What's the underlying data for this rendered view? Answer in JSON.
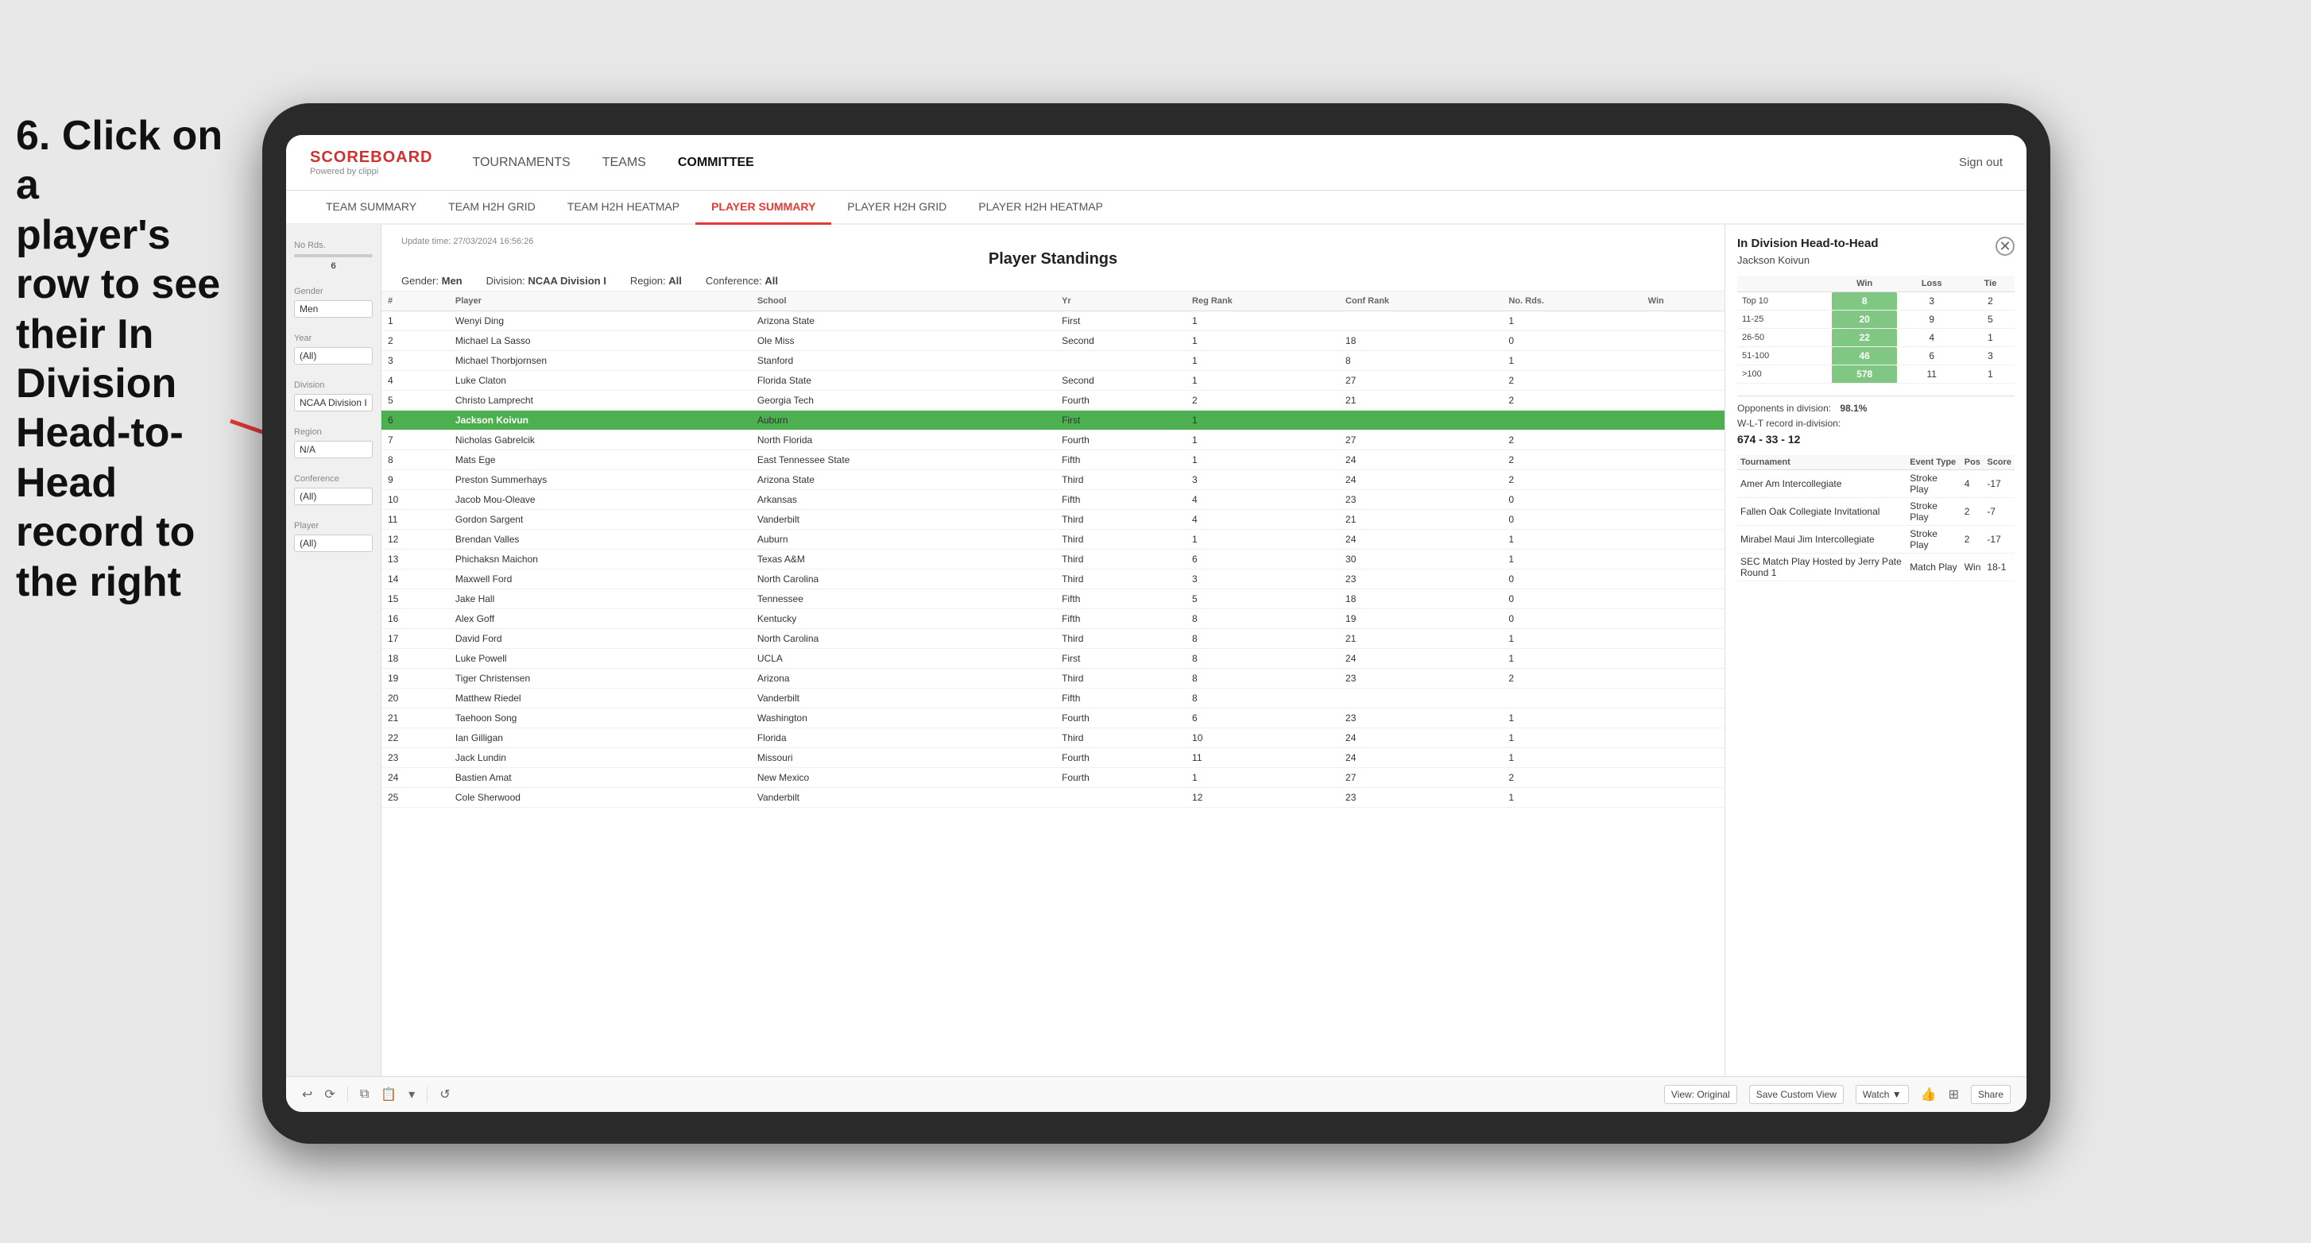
{
  "instruction": {
    "line1": "6. Click on a",
    "line2": "player's row to see",
    "line3": "their In Division",
    "line4": "Head-to-Head",
    "line5": "record to the right"
  },
  "brand": {
    "title": "SCOREBOARD",
    "sub": "Powered by clippi"
  },
  "nav": {
    "items": [
      "TOURNAMENTS",
      "TEAMS",
      "COMMITTEE"
    ],
    "sign_out": "Sign out"
  },
  "sub_nav": {
    "items": [
      "TEAM SUMMARY",
      "TEAM H2H GRID",
      "TEAM H2H HEATMAP",
      "PLAYER SUMMARY",
      "PLAYER H2H GRID",
      "PLAYER H2H HEATMAP"
    ],
    "active": "PLAYER SUMMARY"
  },
  "panel": {
    "title": "Player Standings",
    "update_time": "Update time: 27/03/2024 16:56:26",
    "filters": {
      "gender_label": "Gender:",
      "gender_value": "Men",
      "division_label": "Division:",
      "division_value": "NCAA Division I",
      "region_label": "Region:",
      "region_value": "All",
      "conference_label": "Conference:",
      "conference_value": "All"
    }
  },
  "table": {
    "headers": [
      "#",
      "Player",
      "School",
      "Yr",
      "Reg Rank",
      "Conf Rank",
      "No. Rds.",
      "Win"
    ],
    "rows": [
      {
        "num": 1,
        "player": "Wenyi Ding",
        "school": "Arizona State",
        "yr": "First",
        "reg": 1,
        "conf": "",
        "rds": 1,
        "win": ""
      },
      {
        "num": 2,
        "player": "Michael La Sasso",
        "school": "Ole Miss",
        "yr": "Second",
        "reg": 1,
        "conf": 18,
        "rds": 0,
        "win": ""
      },
      {
        "num": 3,
        "player": "Michael Thorbjornsen",
        "school": "Stanford",
        "yr": "",
        "reg": 1,
        "conf": 8,
        "rds": 1,
        "win": ""
      },
      {
        "num": 4,
        "player": "Luke Claton",
        "school": "Florida State",
        "yr": "Second",
        "reg": 1,
        "conf": 27,
        "rds": 2,
        "win": ""
      },
      {
        "num": 5,
        "player": "Christo Lamprecht",
        "school": "Georgia Tech",
        "yr": "Fourth",
        "reg": 2,
        "conf": 21,
        "rds": 2,
        "win": ""
      },
      {
        "num": 6,
        "player": "Jackson Koivun",
        "school": "Auburn",
        "yr": "First",
        "reg": 1,
        "conf": "",
        "rds": "",
        "win": ""
      },
      {
        "num": 7,
        "player": "Nicholas Gabrelcik",
        "school": "North Florida",
        "yr": "Fourth",
        "reg": 1,
        "conf": 27,
        "rds": 2,
        "win": ""
      },
      {
        "num": 8,
        "player": "Mats Ege",
        "school": "East Tennessee State",
        "yr": "Fifth",
        "reg": 1,
        "conf": 24,
        "rds": 2,
        "win": ""
      },
      {
        "num": 9,
        "player": "Preston Summerhays",
        "school": "Arizona State",
        "yr": "Third",
        "reg": 3,
        "conf": 24,
        "rds": 2,
        "win": ""
      },
      {
        "num": 10,
        "player": "Jacob Mou-Oleave",
        "school": "Arkansas",
        "yr": "Fifth",
        "reg": 4,
        "conf": 23,
        "rds": 0,
        "win": ""
      },
      {
        "num": 11,
        "player": "Gordon Sargent",
        "school": "Vanderbilt",
        "yr": "Third",
        "reg": 4,
        "conf": 21,
        "rds": 0,
        "win": ""
      },
      {
        "num": 12,
        "player": "Brendan Valles",
        "school": "Auburn",
        "yr": "Third",
        "reg": 1,
        "conf": 24,
        "rds": 1,
        "win": ""
      },
      {
        "num": 13,
        "player": "Phichaksn Maichon",
        "school": "Texas A&M",
        "yr": "Third",
        "reg": 6,
        "conf": 30,
        "rds": 1,
        "win": ""
      },
      {
        "num": 14,
        "player": "Maxwell Ford",
        "school": "North Carolina",
        "yr": "Third",
        "reg": 3,
        "conf": 23,
        "rds": 0,
        "win": ""
      },
      {
        "num": 15,
        "player": "Jake Hall",
        "school": "Tennessee",
        "yr": "Fifth",
        "reg": 5,
        "conf": 18,
        "rds": 0,
        "win": ""
      },
      {
        "num": 16,
        "player": "Alex Goff",
        "school": "Kentucky",
        "yr": "Fifth",
        "reg": 8,
        "conf": 19,
        "rds": 0,
        "win": ""
      },
      {
        "num": 17,
        "player": "David Ford",
        "school": "North Carolina",
        "yr": "Third",
        "reg": 8,
        "conf": 21,
        "rds": 1,
        "win": ""
      },
      {
        "num": 18,
        "player": "Luke Powell",
        "school": "UCLA",
        "yr": "First",
        "reg": 8,
        "conf": 24,
        "rds": 1,
        "win": ""
      },
      {
        "num": 19,
        "player": "Tiger Christensen",
        "school": "Arizona",
        "yr": "Third",
        "reg": 8,
        "conf": 23,
        "rds": 2,
        "win": ""
      },
      {
        "num": 20,
        "player": "Matthew Riedel",
        "school": "Vanderbilt",
        "yr": "Fifth",
        "reg": 8,
        "conf": "",
        "rds": "",
        "win": ""
      },
      {
        "num": 21,
        "player": "Taehoon Song",
        "school": "Washington",
        "yr": "Fourth",
        "reg": 6,
        "conf": 23,
        "rds": 1,
        "win": ""
      },
      {
        "num": 22,
        "player": "Ian Gilligan",
        "school": "Florida",
        "yr": "Third",
        "reg": 10,
        "conf": 24,
        "rds": 1,
        "win": ""
      },
      {
        "num": 23,
        "player": "Jack Lundin",
        "school": "Missouri",
        "yr": "Fourth",
        "reg": 11,
        "conf": 24,
        "rds": 1,
        "win": ""
      },
      {
        "num": 24,
        "player": "Bastien Amat",
        "school": "New Mexico",
        "yr": "Fourth",
        "reg": 1,
        "conf": 27,
        "rds": 2,
        "win": ""
      },
      {
        "num": 25,
        "player": "Cole Sherwood",
        "school": "Vanderbilt",
        "yr": "",
        "reg": 12,
        "conf": 23,
        "rds": 1,
        "win": ""
      }
    ]
  },
  "h2h": {
    "title": "In Division Head-to-Head",
    "player": "Jackson Koivun",
    "stats_label": [
      {
        "rank": "Top 10",
        "win": 8,
        "loss": 3,
        "tie": 2
      },
      {
        "rank": "11-25",
        "win": 20,
        "loss": 9,
        "tie": 5
      },
      {
        "rank": "26-50",
        "win": 22,
        "loss": 4,
        "tie": 1
      },
      {
        "rank": "51-100",
        "win": 46,
        "loss": 6,
        "tie": 3
      },
      {
        "rank": ">100",
        "win": 578,
        "loss": 11,
        "tie": 1
      }
    ],
    "col_headers": [
      "Win",
      "Loss",
      "Tie"
    ],
    "opponents_label": "Opponents in division:",
    "opponents_value": "98.1%",
    "wlt_label": "W-L-T record in-division:",
    "wlt_value": "674 - 33 - 12",
    "tournaments": [
      {
        "name": "Amer Am Intercollegiate",
        "type": "Stroke Play",
        "pos": 4,
        "score": -17
      },
      {
        "name": "Fallen Oak Collegiate Invitational",
        "type": "Stroke Play",
        "pos": 2,
        "score": -7
      },
      {
        "name": "Mirabel Maui Jim Intercollegiate",
        "type": "Stroke Play",
        "pos": 2,
        "score": -17
      },
      {
        "name": "SEC Match Play Hosted by Jerry Pate Round 1",
        "type": "Match Play",
        "pos": "Win",
        "score": "18-1"
      }
    ],
    "tournament_headers": [
      "Tournament",
      "Event Type",
      "Pos",
      "Score"
    ]
  },
  "sidebar": {
    "no_rds_label": "No Rds.",
    "no_rds_value": "6",
    "gender_label": "Gender",
    "gender_value": "Men",
    "year_label": "Year",
    "year_value": "(All)",
    "division_label": "Division",
    "division_value": "NCAA Division I",
    "region_label": "Region",
    "region_value": "N/A",
    "conference_label": "Conference",
    "conference_value": "(All)",
    "player_label": "Player",
    "player_value": "(All)"
  },
  "toolbar": {
    "view_original": "View: Original",
    "save_custom": "Save Custom View",
    "watch": "Watch ▼",
    "share": "Share"
  }
}
